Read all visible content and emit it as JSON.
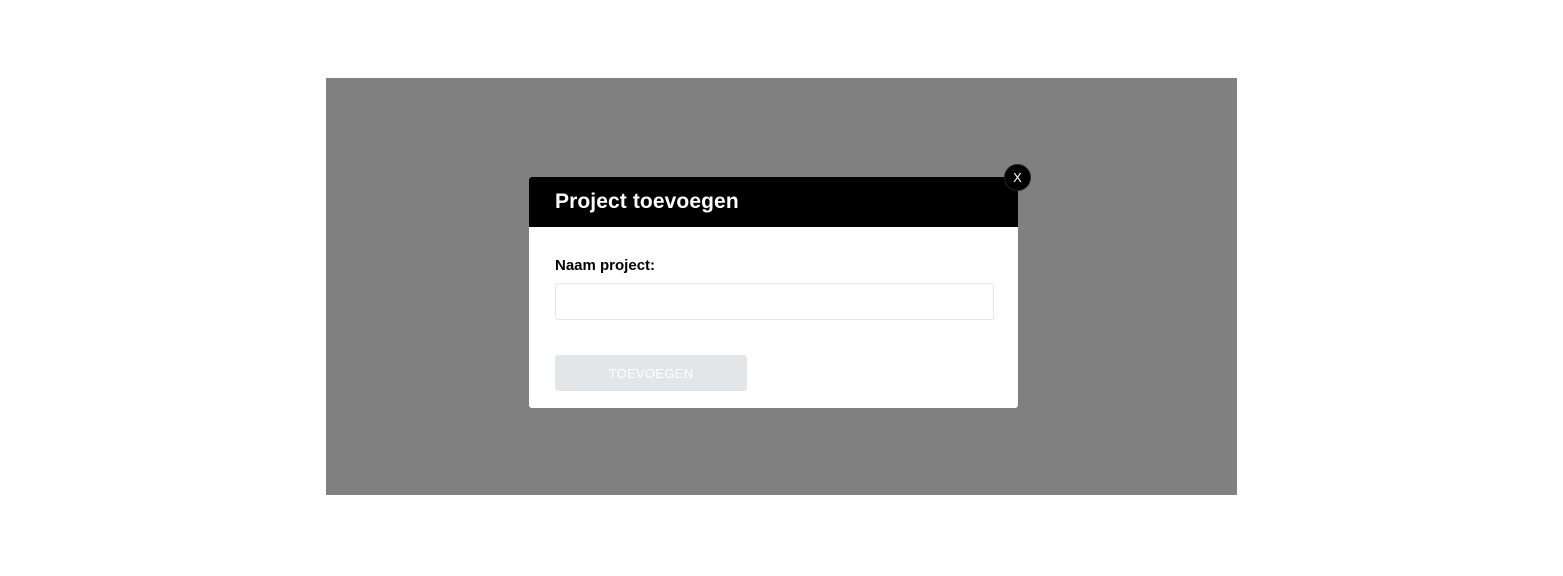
{
  "modal": {
    "title": "Project toevoegen",
    "close_label": "X",
    "field_label": "Naam project:",
    "input_value": "",
    "input_placeholder": "",
    "submit_label": "TOEVOEGEN"
  },
  "colors": {
    "overlay": "#808080",
    "header": "#000000",
    "button_disabled": "#e3e6e9"
  }
}
